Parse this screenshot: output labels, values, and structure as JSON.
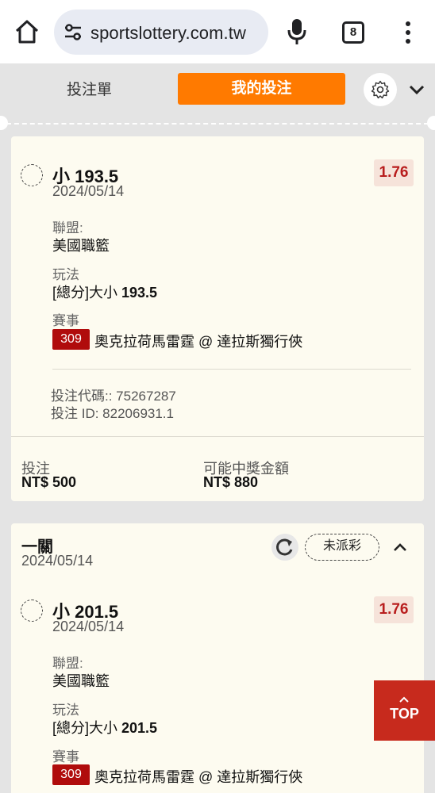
{
  "browser": {
    "url": "sportslottery.com.tw",
    "tab_count": "8",
    "icons": [
      "home-icon",
      "site-settings-icon",
      "mic-icon",
      "tabs-icon",
      "more-vert-icon"
    ]
  },
  "tabs": {
    "betslip_label": "投注單",
    "mybets_label": "我的投注",
    "accent_color": "#ff7a00"
  },
  "bets": [
    {
      "selection": "小 193.5",
      "date": "2024/05/14",
      "odds": "1.76",
      "league_label": "聯盟:",
      "league": "美國職籃",
      "market_label": "玩法",
      "market_prefix": "[總分]大小 ",
      "market_line": "193.5",
      "event_label": "賽事",
      "event_code": "309",
      "event_name": "奧克拉荷馬雷霆 @ 達拉斯獨行俠",
      "bet_code": "投注代碼:: 75267287",
      "bet_id": "投注 ID: 82206931.1",
      "stake_label": "投注",
      "stake": "NT$ 500",
      "payout_label": "可能中獎金額",
      "payout": "NT$ 880"
    },
    {
      "ticket_type": "一關",
      "ticket_date": "2024/05/14",
      "status": "未派彩",
      "selection": "小 201.5",
      "date": "2024/05/14",
      "odds": "1.76",
      "league_label": "聯盟:",
      "league": "美國職籃",
      "market_label": "玩法",
      "market_prefix": "[總分]大小 ",
      "market_line": "201.5",
      "event_label": "賽事",
      "event_code": "309",
      "event_name": "奧克拉荷馬雷霆 @ 達拉斯獨行俠"
    }
  ],
  "scroll_top": {
    "label": "TOP",
    "color": "#c72a1d"
  }
}
